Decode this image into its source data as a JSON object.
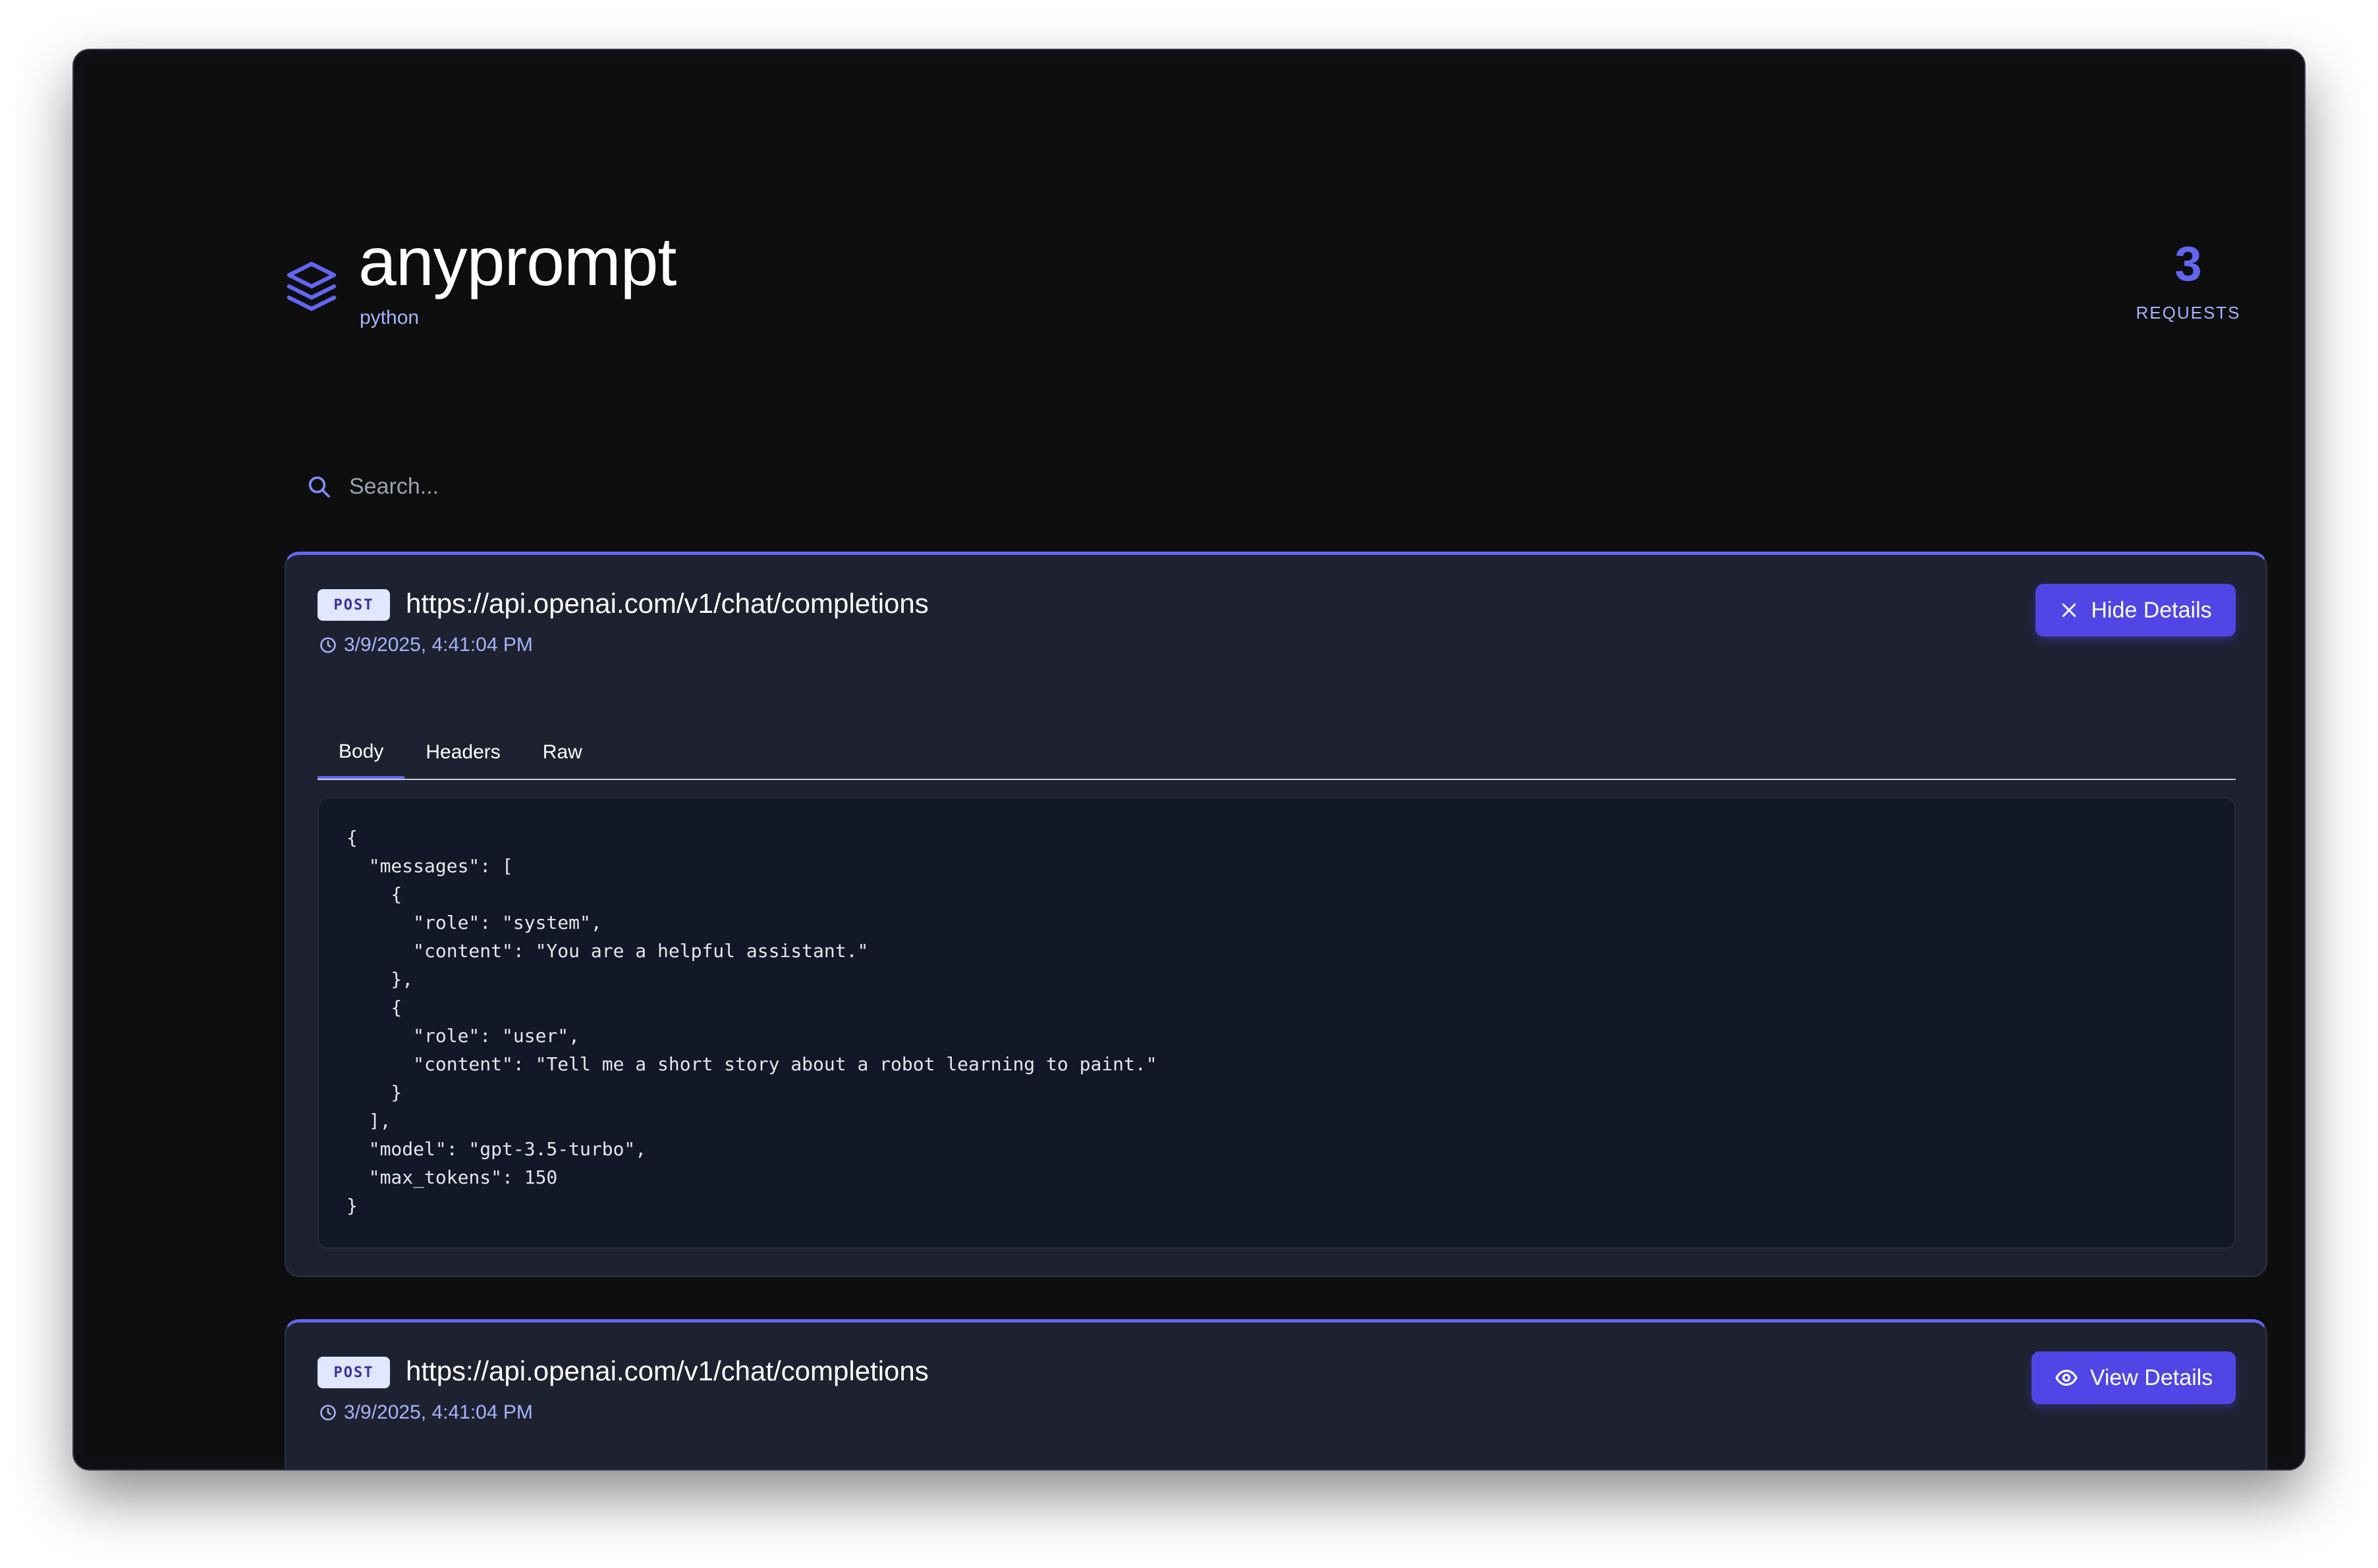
{
  "header": {
    "title": "anyprompt",
    "subtitle": "python",
    "request_count": "3",
    "request_label": "REQUESTS"
  },
  "search": {
    "placeholder": "Search...",
    "value": ""
  },
  "requests": [
    {
      "method": "POST",
      "url": "https://api.openai.com/v1/chat/completions",
      "timestamp": "3/9/2025, 4:41:04 PM",
      "button_label": "Hide Details",
      "tabs": [
        "Body",
        "Headers",
        "Raw"
      ],
      "active_tab": "Body",
      "body": "{\n  \"messages\": [\n    {\n      \"role\": \"system\",\n      \"content\": \"You are a helpful assistant.\"\n    },\n    {\n      \"role\": \"user\",\n      \"content\": \"Tell me a short story about a robot learning to paint.\"\n    }\n  ],\n  \"model\": \"gpt-3.5-turbo\",\n  \"max_tokens\": 150\n}"
    },
    {
      "method": "POST",
      "url": "https://api.openai.com/v1/chat/completions",
      "timestamp": "3/9/2025, 4:41:04 PM",
      "button_label": "View Details"
    }
  ],
  "icons": {
    "logo": "layers-icon",
    "search": "search-icon",
    "time": "clock-icon",
    "hide": "close-icon",
    "view": "eye-icon"
  },
  "colors": {
    "accent": "#6366f1",
    "button": "#4f46e5",
    "card": "#1e2230",
    "background": "#0e0e0f"
  }
}
